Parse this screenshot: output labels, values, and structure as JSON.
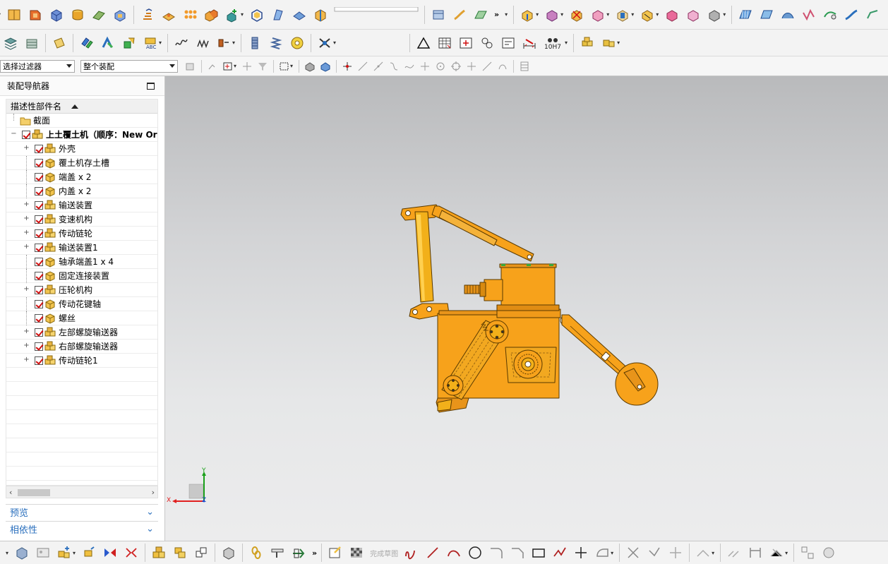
{
  "filters": {
    "selection_filter": "选择过滤器",
    "assembly_scope": "整个装配"
  },
  "toolbar": {
    "fit_tag": "10H7",
    "sketch_done": "完成草图"
  },
  "navigator": {
    "title": "装配导航器",
    "column_header": "描述性部件名",
    "root_folder": "截面",
    "root_assembly": "上土覆土机（顺序：New Ord",
    "items": [
      {
        "label": "外壳",
        "expandable": true,
        "type": "assembly"
      },
      {
        "label": "覆土机存土槽",
        "expandable": false,
        "type": "part"
      },
      {
        "label": "端盖 x 2",
        "expandable": false,
        "type": "part"
      },
      {
        "label": "内盖 x 2",
        "expandable": false,
        "type": "part"
      },
      {
        "label": "输送装置",
        "expandable": true,
        "type": "assembly"
      },
      {
        "label": "变速机构",
        "expandable": true,
        "type": "assembly"
      },
      {
        "label": "传动链轮",
        "expandable": true,
        "type": "assembly"
      },
      {
        "label": "输送装置1",
        "expandable": true,
        "type": "assembly"
      },
      {
        "label": "轴承端盖1 x 4",
        "expandable": false,
        "type": "part"
      },
      {
        "label": "固定连接装置",
        "expandable": false,
        "type": "part"
      },
      {
        "label": "压轮机构",
        "expandable": true,
        "type": "assembly"
      },
      {
        "label": "传动花键轴",
        "expandable": false,
        "type": "part"
      },
      {
        "label": "螺丝",
        "expandable": false,
        "type": "part"
      },
      {
        "label": "左部螺旋输送器",
        "expandable": true,
        "type": "assembly"
      },
      {
        "label": "右部螺旋输送器",
        "expandable": true,
        "type": "assembly"
      },
      {
        "label": "传动链轮1",
        "expandable": true,
        "type": "assembly"
      }
    ],
    "sections": {
      "preview": "预览",
      "dependencies": "相依性"
    }
  },
  "triad": {
    "x": "X",
    "y": "Y",
    "z": "Z"
  },
  "colors": {
    "model_orange": "#f7a21b",
    "model_edge": "#5a3a00",
    "accent_blue": "#2a6fbd",
    "check_red": "#d01010"
  },
  "icons": [
    "shape-icon",
    "box-icon",
    "cylinder-icon",
    "sketch-icon",
    "hole-icon",
    "pattern-icon",
    "assembly-icon",
    "measure-icon",
    "fastener-icon",
    "constraint-icon",
    "cube-view-icon",
    "line-icon",
    "arc-icon",
    "circle-icon",
    "rectangle-icon",
    "dimension-icon"
  ]
}
